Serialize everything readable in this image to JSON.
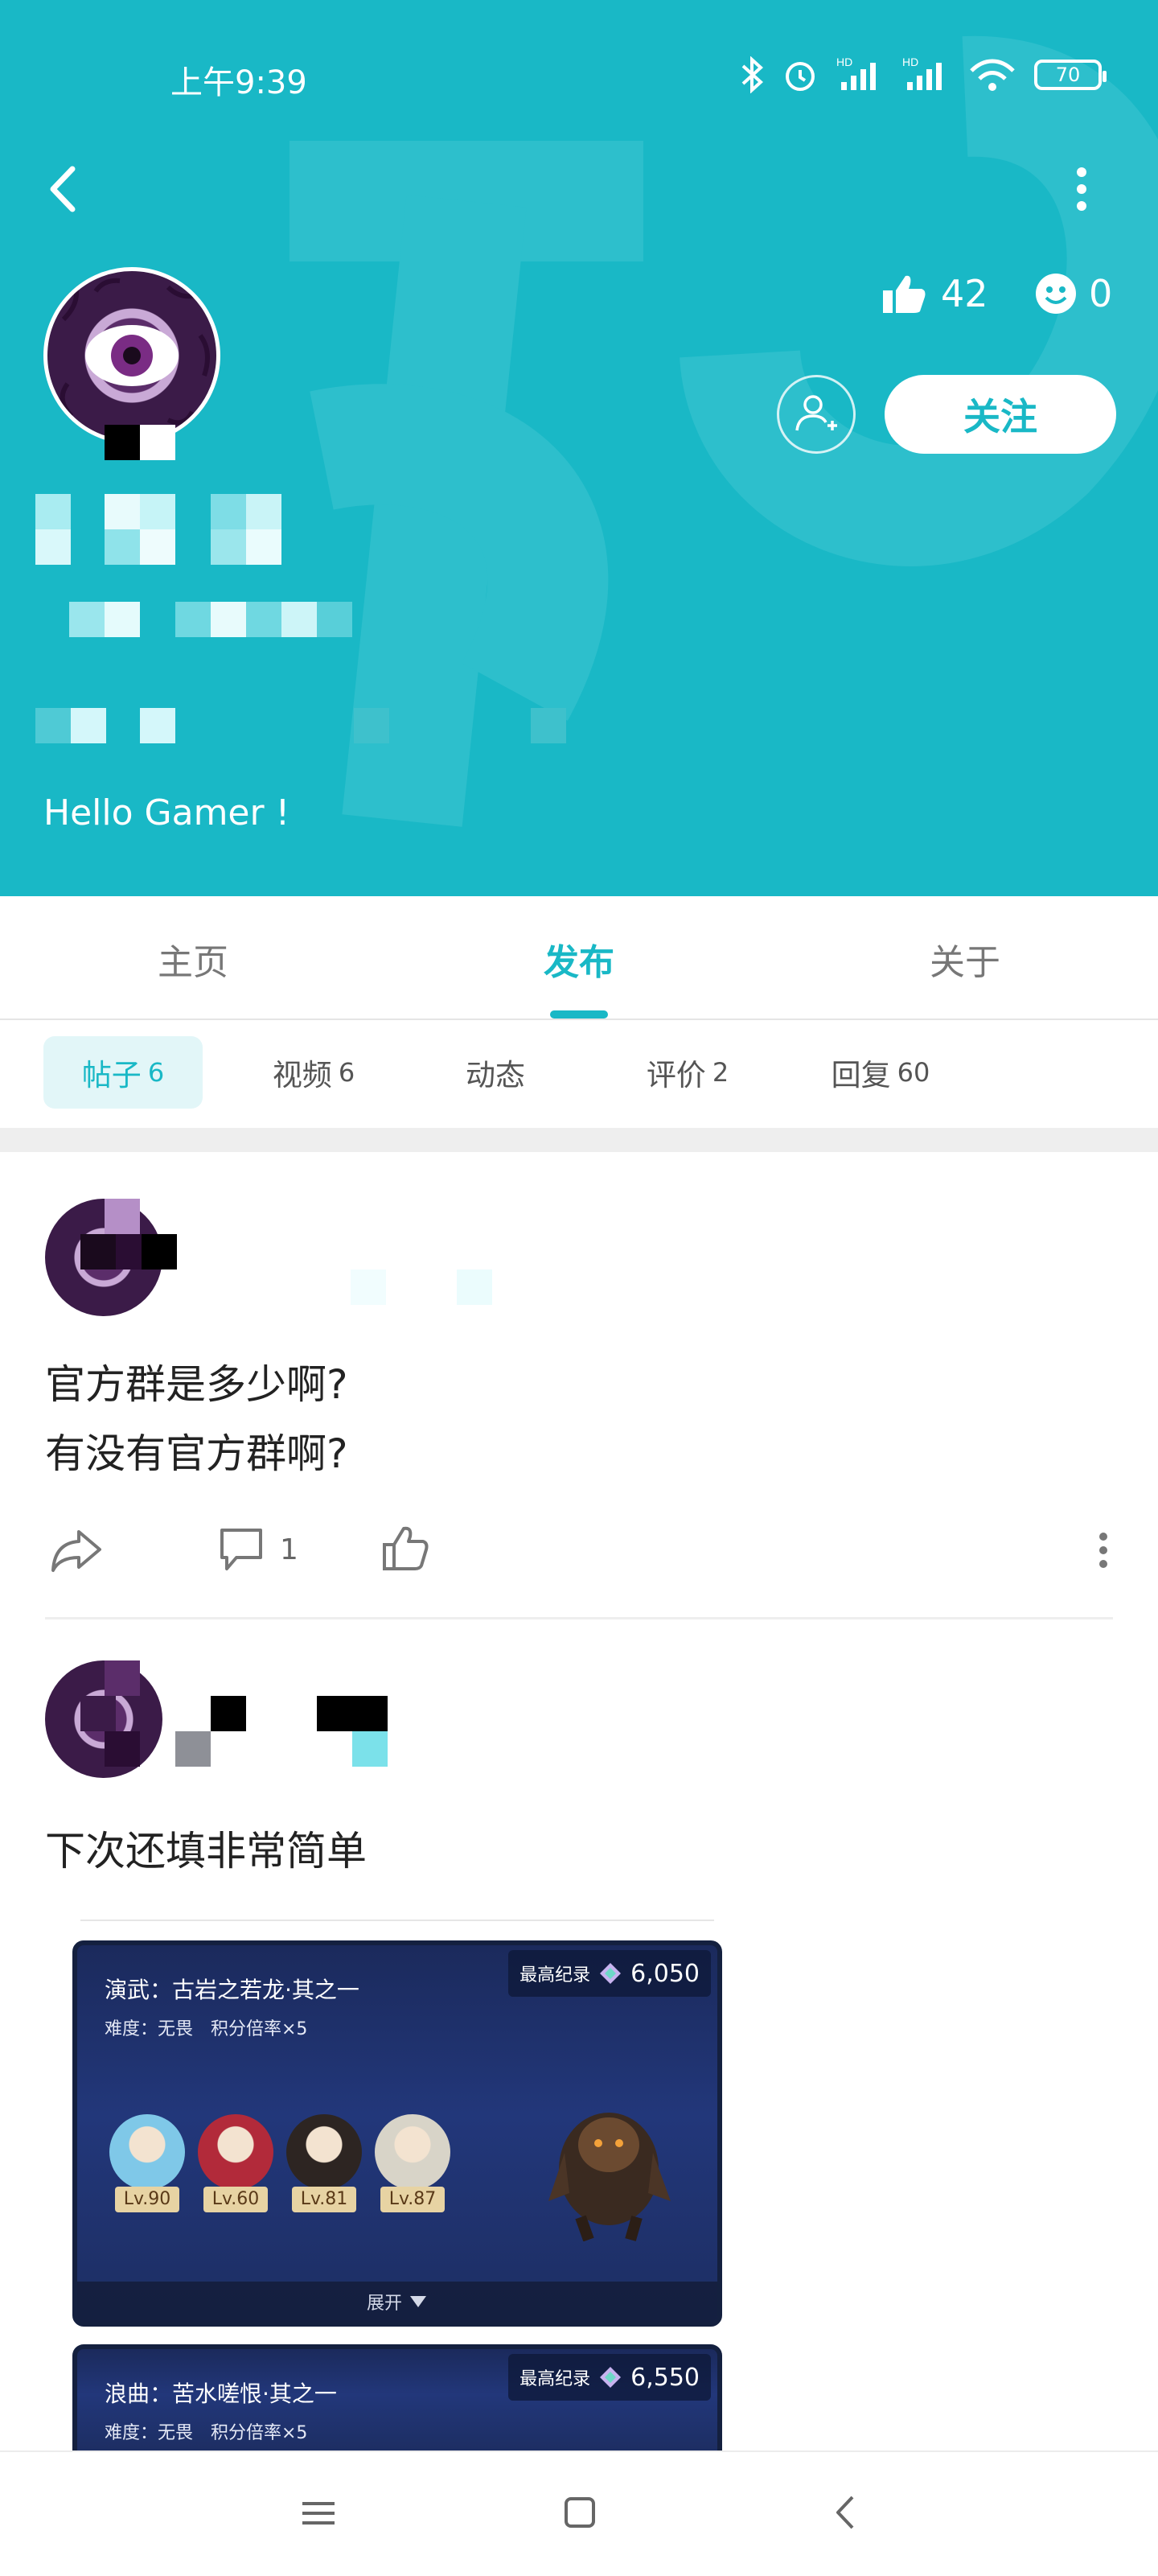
{
  "status_bar": {
    "time": "上午9:39",
    "battery": "70"
  },
  "profile": {
    "likes": "42",
    "reactions": "0",
    "follow_label": "关注",
    "bio": "Hello Gamer !"
  },
  "main_tabs": [
    {
      "label": "主页"
    },
    {
      "label": "发布"
    },
    {
      "label": "关于"
    }
  ],
  "sub_tabs": [
    {
      "label": "帖子",
      "count": "6"
    },
    {
      "label": "视频",
      "count": "6"
    },
    {
      "label": "动态",
      "count": ""
    },
    {
      "label": "评价",
      "count": "2"
    },
    {
      "label": "回复",
      "count": "60"
    }
  ],
  "posts": [
    {
      "text_line1": "官方群是多少啊?",
      "text_line2": "有没有官方群啊?",
      "comments": "1"
    },
    {
      "text": "下次还填非常简单",
      "cards": [
        {
          "title": "演武：古岩之若龙·其之一",
          "subtitle": "难度：无畏　积分倍率×5",
          "record_label": "最高纪录",
          "record_value": "6,050",
          "levels": [
            "Lv.90",
            "Lv.60",
            "Lv.81",
            "Lv.87"
          ],
          "expand": "展开"
        },
        {
          "title": "浪曲：苦水嗟恨·其之一",
          "subtitle": "难度：无畏　积分倍率×5",
          "record_label": "最高纪录",
          "record_value": "6,550"
        }
      ]
    }
  ]
}
